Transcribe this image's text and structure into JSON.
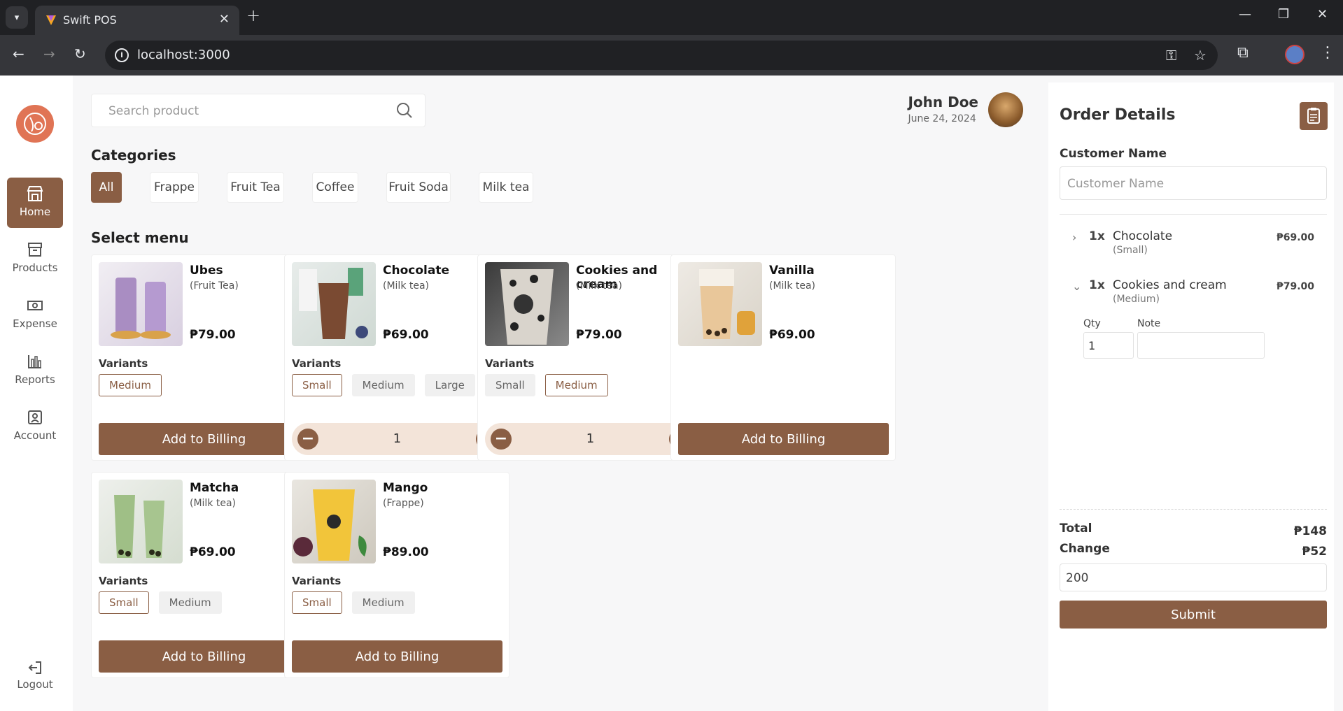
{
  "browser": {
    "tab_title": "Swift POS",
    "url": "localhost:3000"
  },
  "sidebar": {
    "items": [
      {
        "label": "Home",
        "icon": "store-icon",
        "active": true
      },
      {
        "label": "Products",
        "icon": "archive-icon"
      },
      {
        "label": "Expense",
        "icon": "money-icon"
      },
      {
        "label": "Reports",
        "icon": "bar-chart-icon"
      },
      {
        "label": "Account",
        "icon": "user-square-icon"
      }
    ],
    "logout": "Logout"
  },
  "search": {
    "placeholder": "Search product"
  },
  "user": {
    "name": "John Doe",
    "date": "June 24, 2024"
  },
  "categories": {
    "heading": "Categories",
    "items": [
      "All",
      "Frappe",
      "Fruit Tea",
      "Coffee",
      "Fruit Soda",
      "Milk tea"
    ]
  },
  "menu": {
    "heading": "Select menu",
    "variants_label": "Variants",
    "add_label": "Add to Billing",
    "products": [
      {
        "name": "Ubes",
        "category": "(Fruit Tea)",
        "price": "₱79.00",
        "variants": [
          "Medium"
        ],
        "selected": "Medium"
      },
      {
        "name": "Chocolate",
        "category": "(Milk tea)",
        "price": "₱69.00",
        "variants": [
          "Small",
          "Medium",
          "Large"
        ],
        "selected": "Small",
        "qty": "1"
      },
      {
        "name": "Cookies and cream",
        "category": "(Milk tea)",
        "price": "₱79.00",
        "variants": [
          "Small",
          "Medium"
        ],
        "selected": "Medium",
        "qty": "1"
      },
      {
        "name": "Vanilla",
        "category": "(Milk tea)",
        "price": "₱69.00",
        "variants": []
      },
      {
        "name": "Matcha",
        "category": "(Milk tea)",
        "price": "₱69.00",
        "variants": [
          "Small",
          "Medium"
        ],
        "selected": "Small"
      },
      {
        "name": "Mango",
        "category": "(Frappe)",
        "price": "₱89.00",
        "variants": [
          "Small",
          "Medium"
        ],
        "selected": "Small"
      }
    ]
  },
  "order": {
    "title": "Order Details",
    "customer_label": "Customer Name",
    "customer_placeholder": "Customer Name",
    "items": [
      {
        "qty": "1x",
        "name": "Chocolate",
        "size": "(Small)",
        "price": "₱69.00"
      },
      {
        "qty": "1x",
        "name": "Cookies and cream",
        "size": "(Medium)",
        "price": "₱79.00",
        "expanded": true,
        "qty_label": "Qty",
        "qty_value": "1",
        "note_label": "Note",
        "note_value": ""
      }
    ],
    "total_label": "Total",
    "total_value": "₱148",
    "change_label": "Change",
    "change_value": "₱52",
    "cash_value": "200",
    "submit_label": "Submit"
  },
  "colors": {
    "accent": "#8a5e44",
    "accent_light": "#f3e4d9",
    "logo": "#e07455"
  }
}
